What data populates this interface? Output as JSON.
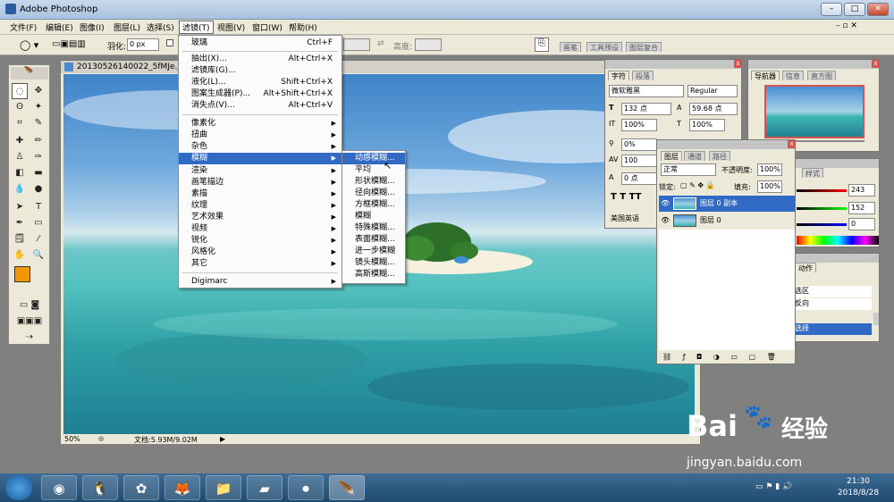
{
  "app": {
    "title": "Adobe Photoshop"
  },
  "menubar": [
    "文件(F)",
    "编辑(E)",
    "图像(I)",
    "图层(L)",
    "选择(S)",
    "滤镜(T)",
    "视图(V)",
    "窗口(W)",
    "帮助(H)"
  ],
  "options": {
    "feather_label": "羽化:",
    "feather_value": "0 px",
    "height_label": "高度:",
    "palette_tabs": [
      "画笔",
      "工具预设",
      "图层复合"
    ]
  },
  "document": {
    "title": "20130526140022_5fMJe.jpg",
    "zoom": "50%",
    "docsize": "文档:5.93M/9.02M"
  },
  "filter_menu": {
    "items": [
      {
        "label": "玻璃",
        "shortcut": "Ctrl+F"
      },
      {
        "label": "抽出(X)...",
        "shortcut": "Alt+Ctrl+X"
      },
      {
        "label": "滤镜库(G)...",
        "shortcut": ""
      },
      {
        "label": "液化(L)...",
        "shortcut": "Shift+Ctrl+X"
      },
      {
        "label": "图案生成器(P)...",
        "shortcut": "Alt+Shift+Ctrl+X"
      },
      {
        "label": "消失点(V)...",
        "shortcut": "Alt+Ctrl+V"
      },
      {
        "label": "像素化",
        "shortcut": ""
      },
      {
        "label": "扭曲",
        "shortcut": ""
      },
      {
        "label": "杂色",
        "shortcut": ""
      },
      {
        "label": "模糊",
        "shortcut": ""
      },
      {
        "label": "渲染",
        "shortcut": ""
      },
      {
        "label": "画笔描边",
        "shortcut": ""
      },
      {
        "label": "素描",
        "shortcut": ""
      },
      {
        "label": "纹理",
        "shortcut": ""
      },
      {
        "label": "艺术效果",
        "shortcut": ""
      },
      {
        "label": "视频",
        "shortcut": ""
      },
      {
        "label": "锐化",
        "shortcut": ""
      },
      {
        "label": "风格化",
        "shortcut": ""
      },
      {
        "label": "其它",
        "shortcut": ""
      },
      {
        "label": "Digimarc",
        "shortcut": ""
      }
    ]
  },
  "blur_submenu": [
    "动感模糊...",
    "平均",
    "形状模糊...",
    "径向模糊...",
    "方框模糊...",
    "模糊",
    "特殊模糊...",
    "表面模糊...",
    "进一步模糊",
    "镜头模糊...",
    "高斯模糊..."
  ],
  "character_panel": {
    "tabs": [
      "字符",
      "段落"
    ],
    "font": "微软雅黑",
    "style": "Regular",
    "size": "132 点",
    "leading": "59.68 点",
    "vscale": "100%",
    "hscale": "100%",
    "tracking_a": "0%",
    "tracking_b": "100",
    "baseline": "0 点",
    "language": "美国英语"
  },
  "layers_panel": {
    "tabs": [
      "图层",
      "通道",
      "路径"
    ],
    "blend": "正常",
    "opacity_label": "不透明度:",
    "opacity": "100%",
    "lock_label": "锁定:",
    "fill_label": "填充:",
    "fill": "100%",
    "layers": [
      "图层 0 副本",
      "图层 0"
    ]
  },
  "navigator_panel": {
    "tabs": [
      "导航器",
      "信息",
      "直方图"
    ]
  },
  "color_panel": {
    "tab": "样式",
    "values": [
      "243",
      "152",
      "0"
    ]
  },
  "history_panel": {
    "tab": "动作",
    "items": [
      "选区",
      "反向",
      "选择"
    ]
  },
  "taskbar": {
    "time": "21:30",
    "date": "2018/8/28"
  },
  "watermark": {
    "brand": "Bai",
    "brand2": "经验",
    "url": "jingyan.baidu.com"
  },
  "colors": {
    "foreground": "#f39800",
    "accent": "#316ac5"
  }
}
